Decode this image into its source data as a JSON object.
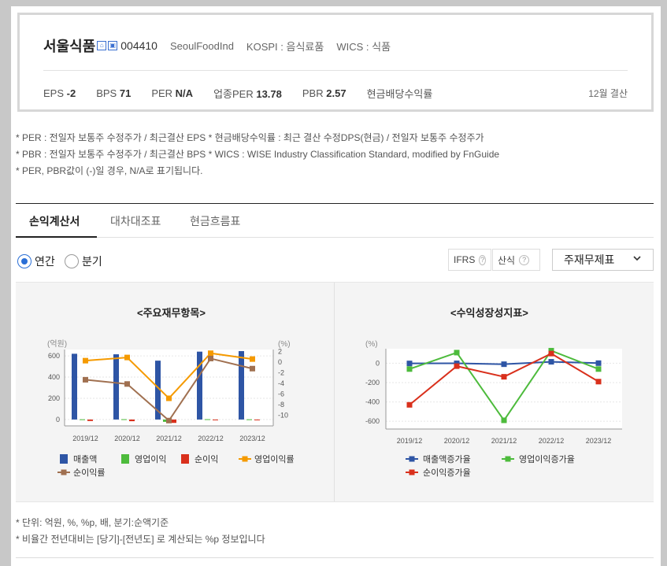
{
  "header": {
    "corp_name": "서울식품",
    "icons": [
      "home-icon",
      "store-icon"
    ],
    "code": "004410",
    "english_name": "SeoulFoodInd",
    "market": "KOSPI : 음식료품",
    "wics": "WICS : 식품",
    "metrics": [
      {
        "label": "EPS",
        "value": "-2"
      },
      {
        "label": "BPS",
        "value": "71"
      },
      {
        "label": "PER",
        "value": "N/A"
      },
      {
        "label": "업종PER",
        "value": "13.78"
      },
      {
        "label": "PBR",
        "value": "2.57"
      },
      {
        "label": "현금배당수익률",
        "value": ""
      }
    ],
    "settlement": "12월 결산"
  },
  "notes": [
    "* PER : 전일자 보통주 수정주가 / 최근결산 EPS * 현금배당수익률 : 최근 결산 수정DPS(현금) / 전일자 보통주 수정주가",
    "* PBR : 전일자 보통주 수정주가 / 최근결산 BPS * WICS : WISE Industry Classification Standard, modified by FnGuide",
    "* PER, PBR값이 (-)일 경우, N/A로 표기됩니다."
  ],
  "tabs": [
    "손익계산서",
    "대차대조표",
    "현금흐름표"
  ],
  "controls": {
    "radio_annual": "연간",
    "radio_quarter": "분기",
    "ifrs_label": "IFRS",
    "calc_label": "산식",
    "dropdown_value": "주재무제표"
  },
  "chart_data": [
    {
      "type": "bar",
      "title": "<주요재무항목>",
      "left_unit": "(억원)",
      "right_unit": "(%)",
      "categories": [
        "2019/12",
        "2020/12",
        "2021/12",
        "2022/12",
        "2023/12"
      ],
      "y_ticks": [
        0,
        200,
        400,
        600
      ],
      "y2_ticks": [
        2,
        0,
        -2,
        -4,
        -6,
        -8,
        -10
      ],
      "ylim": [
        -60,
        660
      ],
      "y2lim": [
        -12,
        2.4
      ],
      "bar_series": [
        {
          "name": "매출액",
          "values": [
            620,
            615,
            555,
            640,
            645
          ],
          "color": "#2e55a5"
        },
        {
          "name": "영업이익",
          "values": [
            2,
            3,
            -22,
            3,
            2
          ],
          "color": "#4dbb3c"
        },
        {
          "name": "순이익",
          "values": [
            -14,
            -16,
            -32,
            -1,
            -2
          ],
          "color": "#d9301c"
        }
      ],
      "line_series": [
        {
          "name": "영업이익률",
          "values": [
            0.3,
            0.9,
            -6.8,
            1.7,
            0.6
          ],
          "color": "#f59a00"
        },
        {
          "name": "순이익률",
          "values": [
            -3.3,
            -4.1,
            -11.0,
            0.7,
            -1.2
          ],
          "color": "#a07050"
        }
      ],
      "legend": [
        "매출액",
        "영업이익",
        "순이익",
        "영업이익률",
        "순이익률"
      ]
    },
    {
      "type": "line",
      "title": "<수익성장성지표>",
      "left_unit": "(%)",
      "categories": [
        "2019/12",
        "2020/12",
        "2021/12",
        "2022/12",
        "2023/12"
      ],
      "y_ticks": [
        0,
        -200,
        -400,
        -600
      ],
      "ylim": [
        -680,
        150
      ],
      "series": [
        {
          "name": "매출액증가율",
          "values": [
            -2,
            -1,
            -10,
            15,
            1
          ],
          "color": "#2e55a5"
        },
        {
          "name": "영업이익증가율",
          "values": [
            -60,
            110,
            -590,
            130,
            -60
          ],
          "color": "#4dbb3c"
        },
        {
          "name": "순이익증가율",
          "values": [
            -430,
            -30,
            -140,
            100,
            -190
          ],
          "color": "#d9301c"
        }
      ],
      "legend": [
        "매출액증가율",
        "영업이익증가율",
        "순이익증가율"
      ]
    }
  ],
  "footnotes": [
    "* 단위: 억원, %, %p, 배, 분기:순액기준",
    "* 비율간 전년대비는 [당기]-[전년도] 로 계산되는 %p 정보입니다"
  ]
}
